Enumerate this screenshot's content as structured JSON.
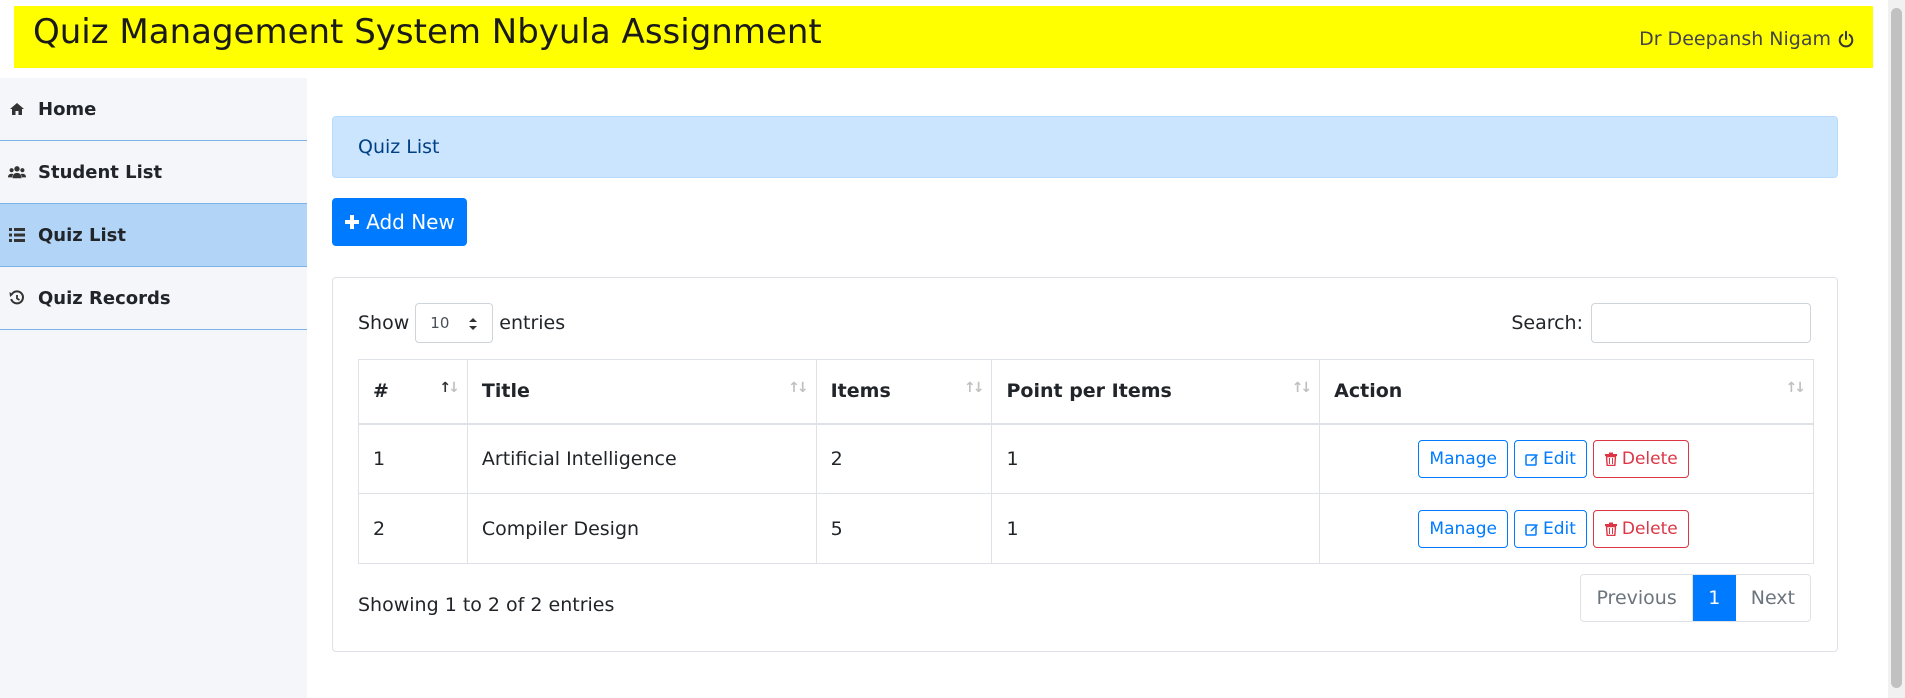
{
  "header": {
    "title": "Quiz Management System Nbyula Assignment",
    "user_name": "Dr Deepansh Nigam",
    "logout_icon": "power-icon",
    "background_color": "#ffff00"
  },
  "sidebar": {
    "items": [
      {
        "label": "Home",
        "icon": "home-icon",
        "active": false
      },
      {
        "label": "Student List",
        "icon": "users-icon",
        "active": false
      },
      {
        "label": "Quiz List",
        "icon": "list-icon",
        "active": true
      },
      {
        "label": "Quiz Records",
        "icon": "history-icon",
        "active": false
      }
    ]
  },
  "main": {
    "page_title": "Quiz List",
    "add_button": "Add New",
    "table_controls": {
      "show_label": "Show",
      "entries_value": "10",
      "entries_label": "entries",
      "search_label": "Search:"
    },
    "table": {
      "columns": [
        "#",
        "Title",
        "Items",
        "Point per Items",
        "Action"
      ],
      "rows": [
        {
          "num": "1",
          "title": "Artificial Intelligence",
          "items": "2",
          "points": "1"
        },
        {
          "num": "2",
          "title": "Compiler Design",
          "items": "5",
          "points": "1"
        }
      ],
      "action_labels": {
        "manage": "Manage",
        "edit": "Edit",
        "delete": "Delete"
      }
    },
    "info": "Showing 1 to 2 of 2 entries",
    "pagination": {
      "previous": "Previous",
      "current": "1",
      "next": "Next"
    }
  },
  "colors": {
    "primary": "#007bff",
    "danger": "#dc3545",
    "active_nav": "#b1d4f7",
    "alert_bg": "#cce5ff"
  }
}
